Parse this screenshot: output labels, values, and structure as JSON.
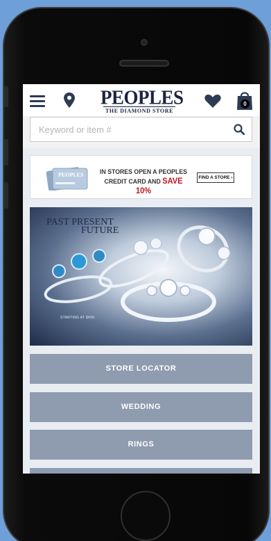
{
  "header": {
    "logo_main": "PEOPLES",
    "logo_sub": "THE DIAMOND STORE",
    "cart_count": "0"
  },
  "search": {
    "placeholder": "Keyword or item #"
  },
  "promo": {
    "line1": "IN STORES OPEN A PEOPLES",
    "line2_prefix": "CREDIT CARD AND",
    "highlight": "SAVE 10%",
    "cta": "FIND A STORE ›",
    "card_text": "PEOPLES"
  },
  "banner": {
    "title_line1": "PAST PRESENT",
    "title_line2": "FUTURE",
    "starting_at": "STARTING AT $499"
  },
  "nav": {
    "items": [
      {
        "label": "STORE LOCATOR"
      },
      {
        "label": "WEDDING"
      },
      {
        "label": "RINGS"
      }
    ]
  },
  "colors": {
    "background": "#6f9fd8",
    "brand_navy": "#1c2440",
    "nav_button": "#8f9bae",
    "promo_red": "#c4161c"
  }
}
